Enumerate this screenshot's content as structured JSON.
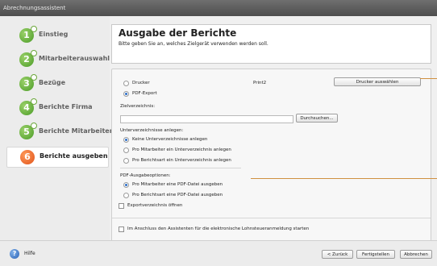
{
  "window": {
    "title": "Abrechnungsassistent"
  },
  "sidebar": {
    "steps": [
      {
        "num": "1",
        "label": "Einstieg"
      },
      {
        "num": "2",
        "label": "Mitarbeiterauswahl"
      },
      {
        "num": "3",
        "label": "Bezüge"
      },
      {
        "num": "4",
        "label": "Berichte Firma"
      },
      {
        "num": "5",
        "label": "Berichte Mitarbeiter"
      },
      {
        "num": "6",
        "label": "Berichte ausgeben"
      }
    ]
  },
  "header": {
    "title": "Ausgabe der Berichte",
    "subtitle": "Bitte geben Sie an, welches Zielgerät verwenden werden soll."
  },
  "output": {
    "printer_label": "Drucker",
    "printer_name": "Print2",
    "select_printer_button": "Drucker auswählen",
    "pdf_label": "PDF-Export",
    "target_dir_label": "Zielverzeichnis:",
    "target_dir_value": "",
    "browse_button": "Durchsuchen...",
    "subdir_heading": "Unterverzeichnisse anlegen:",
    "subdir_options": [
      "Keine Unterverzeichnisse anlegen",
      "Pro Mitarbeiter ein Unterverzeichnis anlegen",
      "Pro Berichtsart ein Unterverzeichnis anlegen"
    ],
    "pdf_options_heading": "PDF-Ausgabeoptionen:",
    "pdf_options": [
      "Pro Mitarbeiter eine PDF-Datei ausgeben",
      "Pro Berichtsart eine PDF-Datei ausgeben"
    ],
    "open_dir_label": "Exportverzeichnis öffnen",
    "start_assistant_label": "Im Anschluss den Assistenten für die elektronische Lohnsteueranmeldung starten"
  },
  "footer": {
    "help_label": "Hilfe",
    "back_button": "< Zurück",
    "finish_button": "Fertigstellen",
    "cancel_button": "Abbrechen"
  },
  "colors": {
    "step_done": "#4a9b26",
    "step_active": "#e0521a",
    "radio_selected": "#2e6fc8",
    "annotation_line": "#d09040"
  }
}
